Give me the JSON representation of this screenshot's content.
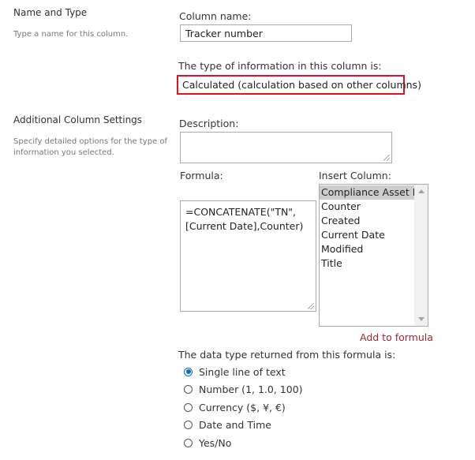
{
  "name_and_type": {
    "title": "Name and Type",
    "description": "Type a name for this column.",
    "column_name_label": "Column name:",
    "column_name_value": "Tracker number",
    "type_label": "The type of information in this column is:",
    "type_value": "Calculated (calculation based on other columns)"
  },
  "additional_settings": {
    "title": "Additional Column Settings",
    "description_lines": [
      "Specify detailed options for the type of",
      "information you selected."
    ],
    "description_label": "Description:",
    "description_value": "",
    "formula_label": "Formula:",
    "formula_lines": [
      "=CONCATENATE(\"TN\",",
      "[Current Date],Counter)"
    ],
    "insert_column_label": "Insert Column:",
    "insert_columns": [
      "Compliance Asset Id",
      "Counter",
      "Created",
      "Current Date",
      "Modified",
      "Title"
    ],
    "selected_insert_column": "Compliance Asset Id",
    "add_to_formula_label": "Add to formula",
    "return_type_label": "The data type returned from this formula is:",
    "return_types": [
      {
        "label": "Single line of text",
        "checked": true
      },
      {
        "label": "Number (1, 1.0, 100)",
        "checked": false
      },
      {
        "label": "Currency ($, ¥, €)",
        "checked": false
      },
      {
        "label": "Date and Time",
        "checked": false
      },
      {
        "label": "Yes/No",
        "checked": false
      }
    ]
  },
  "colors": {
    "highlight_border": "#e3101e",
    "link": "#a4262c",
    "radio_accent": "#0f6cbd"
  }
}
